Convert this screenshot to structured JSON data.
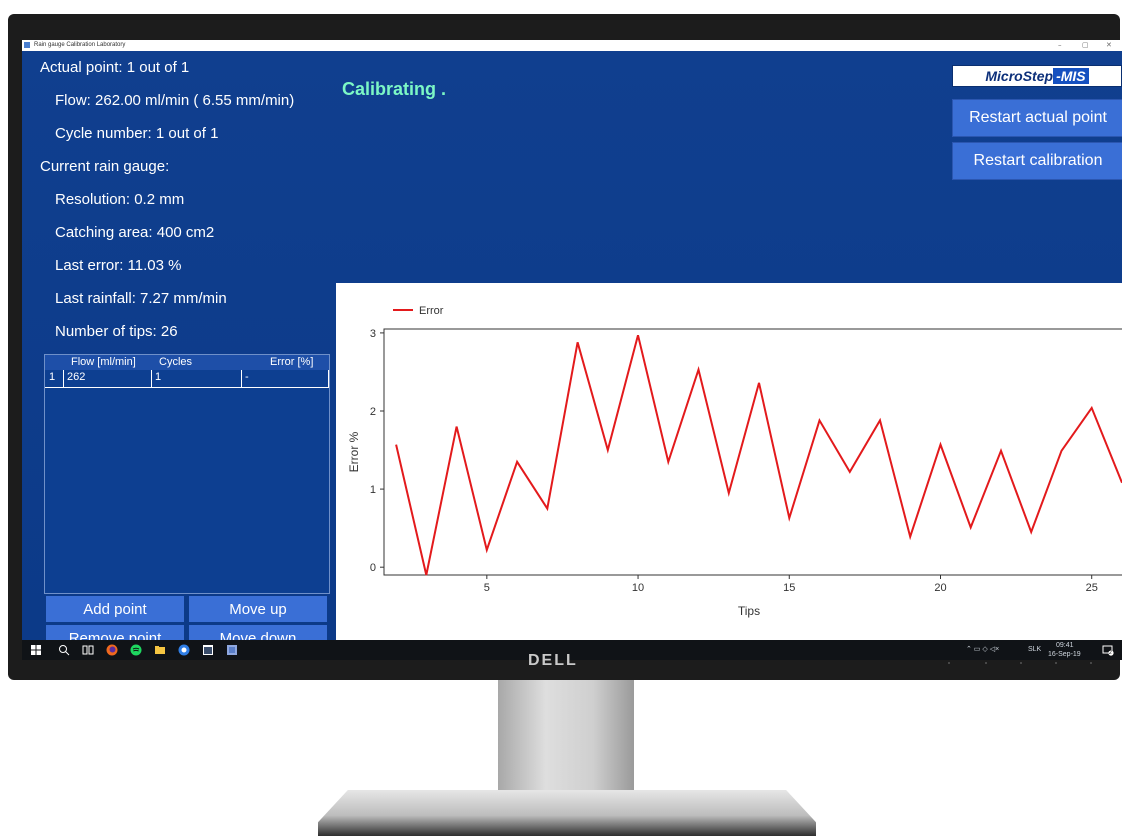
{
  "window": {
    "title": "Rain gauge Calibration Laboratory",
    "controls": [
      "–",
      "▢",
      "✕"
    ]
  },
  "info": {
    "actual_point": "Actual point: 1 out of 1",
    "flow": "Flow: 262.00 ml/min ( 6.55 mm/min)",
    "cycle_number": "Cycle number: 1 out of 1",
    "current_gauge": "Current rain gauge:",
    "resolution": "Resolution: 0.2  mm",
    "catching_area": "Catching area: 400  cm2",
    "last_error": "Last error: 11.03 %",
    "last_rainfall": "Last rainfall: 7.27 mm/min",
    "number_of_tips": "Number of tips: 26"
  },
  "status": {
    "text": "Calibrating ."
  },
  "logo": {
    "left": "MicroStep",
    "right": "-MIS"
  },
  "buttons": {
    "restart_actual_point": "Restart actual point",
    "restart_calibration": "Restart calibration",
    "add_point": "Add point",
    "move_up": "Move up",
    "remove_point": "Remove point",
    "move_down": "Move down"
  },
  "table": {
    "columns": [
      "Flow [ml/min]",
      "Cycles",
      "Error [%]"
    ],
    "rows": [
      {
        "index": "1",
        "flow": "262",
        "cycles": "1",
        "error": "-"
      }
    ]
  },
  "taskbar": {
    "time": "09:41",
    "date": "16-Sep-19",
    "lang": "SLK",
    "notification_count": "2"
  },
  "monitor": {
    "brand": "DELL"
  },
  "chart_data": {
    "type": "line",
    "xlabel": "Tips",
    "ylabel": "Error %",
    "xlim": [
      1.6,
      26.2
    ],
    "ylim": [
      -0.1,
      3.05
    ],
    "xticks": [
      5,
      10,
      15,
      20,
      25
    ],
    "yticks": [
      0,
      1,
      2,
      3
    ],
    "legend": "top-left",
    "grid": false,
    "series": [
      {
        "name": "Error",
        "color": "#e31a1c",
        "x": [
          2,
          3,
          4,
          5,
          6,
          7,
          8,
          9,
          10,
          11,
          12,
          13,
          14,
          15,
          16,
          17,
          18,
          19,
          20,
          21,
          22,
          23,
          24,
          25,
          26
        ],
        "y": [
          1.57,
          -0.1,
          1.8,
          0.22,
          1.35,
          0.75,
          2.88,
          1.5,
          2.97,
          1.35,
          2.53,
          0.95,
          2.36,
          0.63,
          1.88,
          1.22,
          1.88,
          0.39,
          1.57,
          0.51,
          1.49,
          0.45,
          1.49,
          2.04,
          1.08
        ]
      }
    ]
  }
}
